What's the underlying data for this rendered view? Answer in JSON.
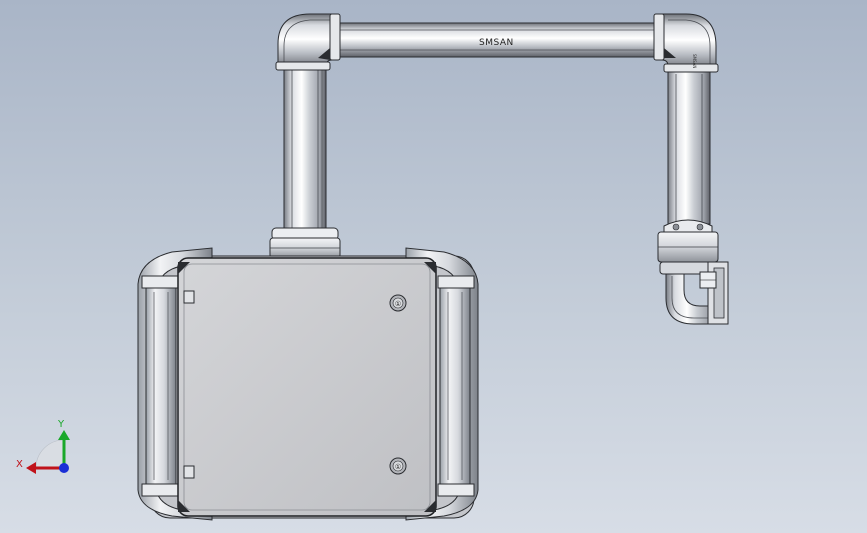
{
  "app": {
    "viewport_kind": "3D CAD model view"
  },
  "model": {
    "brand_label": "SMSAN",
    "arm_side_label": "SMSAN",
    "panel_badges": [
      "①",
      "①"
    ]
  },
  "triad": {
    "x_label": "X",
    "y_label": "Y",
    "colors": {
      "x": "#c0121a",
      "y": "#19a82a",
      "z": "#1a2fd6"
    }
  },
  "colors": {
    "background_top": "#a9b5c7",
    "background_bottom": "#d7dde6",
    "metal_light": "#eef0f3",
    "metal_mid": "#c9ccd2",
    "metal_dark": "#6e7279",
    "panel": "#c8c9cd",
    "outline": "#2a2c30"
  }
}
